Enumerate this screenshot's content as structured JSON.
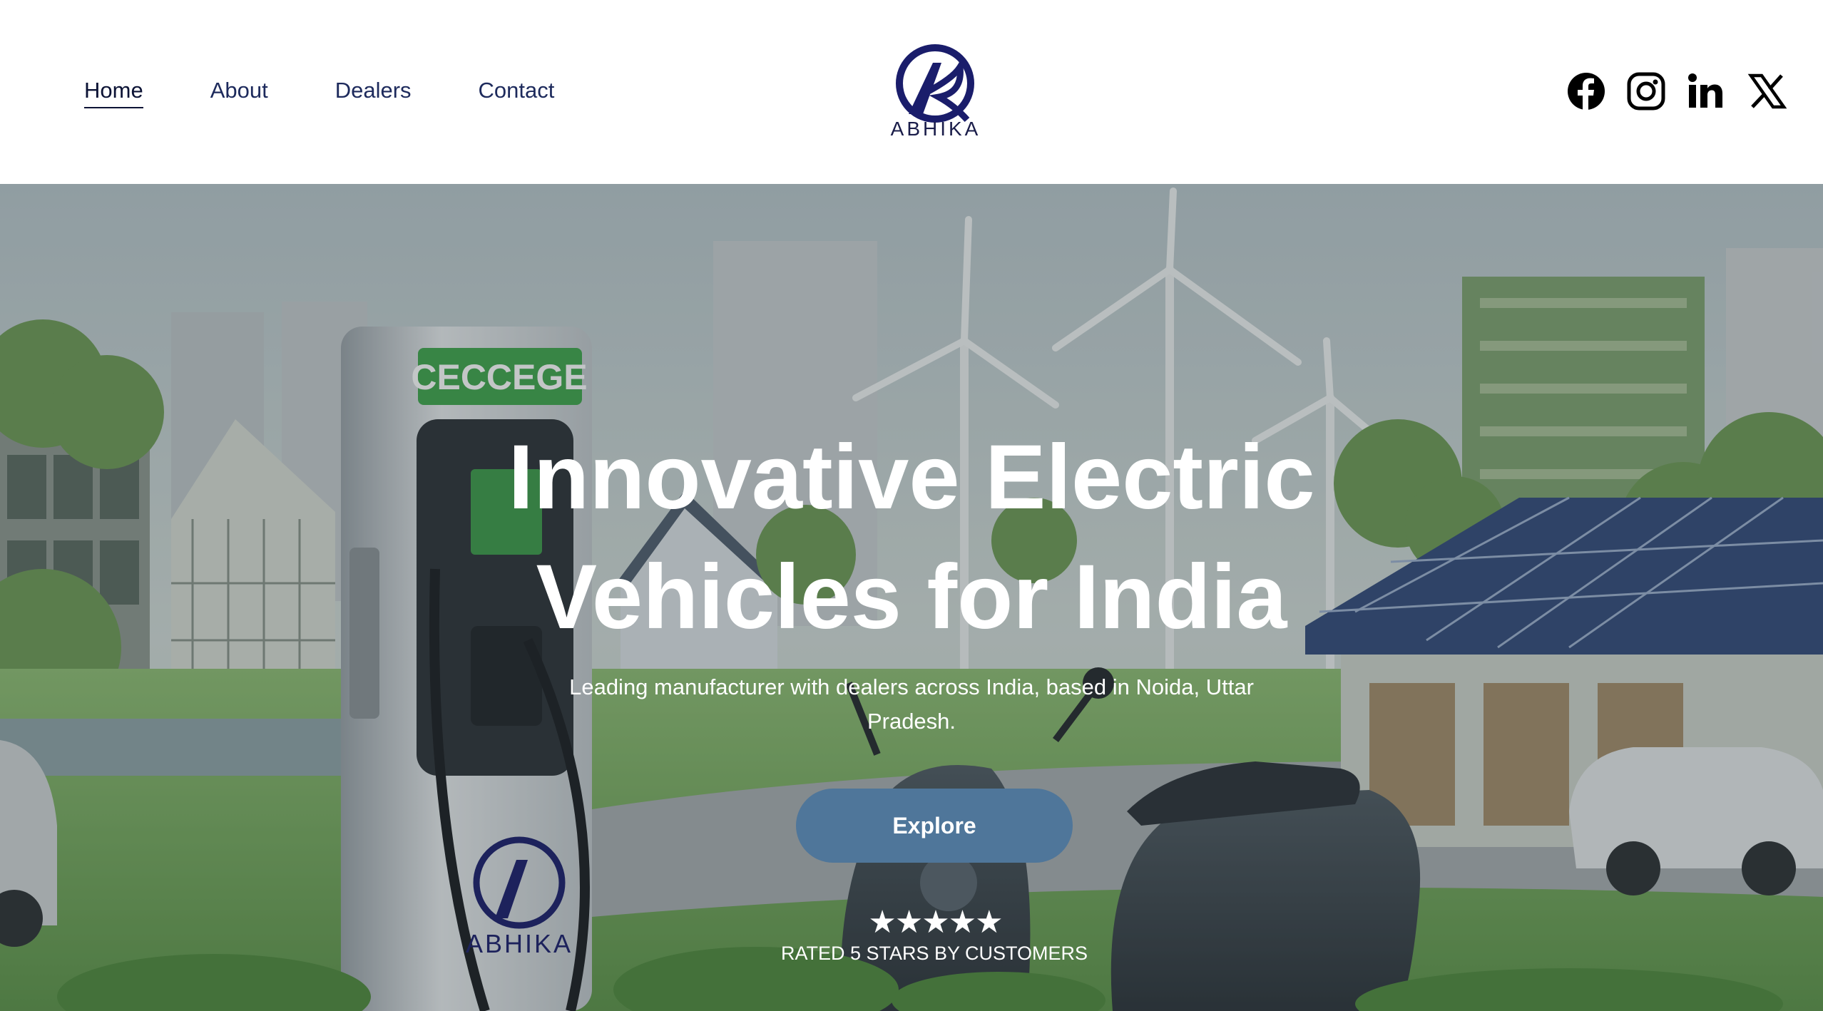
{
  "nav": {
    "items": [
      {
        "label": "Home",
        "active": true
      },
      {
        "label": "About",
        "active": false
      },
      {
        "label": "Dealers",
        "active": false
      },
      {
        "label": "Contact",
        "active": false
      }
    ]
  },
  "brand": {
    "name": "ABHIKA",
    "color": "#1a1d6b"
  },
  "social": [
    "facebook-icon",
    "instagram-icon",
    "linkedin-icon",
    "x-icon"
  ],
  "hero": {
    "headline_line1": "Innovative Electric",
    "headline_line2": "Vehicles for India",
    "subtitle": "Leading manufacturer with dealers across India, based in Noida, Uttar Pradesh.",
    "cta_label": "Explore",
    "stars": "★★★★★",
    "rating_text": "RATED 5 STARS BY CUSTOMERS",
    "charger_sign": "CECCEGE",
    "charger_brand": "ABHIKA"
  },
  "colors": {
    "cta": "#4f769a",
    "nav_text": "#1d2a5c"
  }
}
